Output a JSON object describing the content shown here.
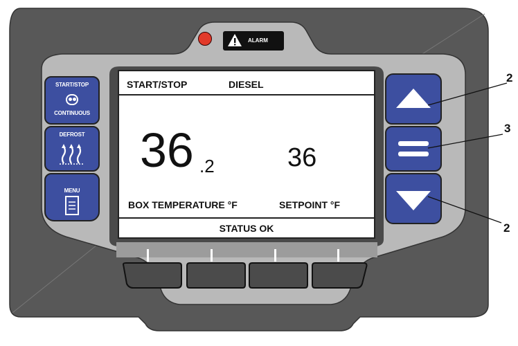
{
  "alarm": {
    "label": "ALARM"
  },
  "left_buttons": {
    "start_stop": {
      "label_top": "START/STOP",
      "label_bottom": "CONTINUOUS"
    },
    "defrost": {
      "label": "DEFROST"
    },
    "menu": {
      "label": "MENU"
    }
  },
  "display": {
    "mode": "START/STOP",
    "engine": "DIESEL",
    "box_temp_whole": "36",
    "box_temp_decimal": ".2",
    "setpoint_value": "36",
    "box_temp_label": "BOX TEMPERATURE °F",
    "setpoint_label": "SETPOINT °F",
    "status": "STATUS OK"
  },
  "callouts": {
    "up": "2",
    "select": "3",
    "down": "2"
  },
  "colors": {
    "button_blue": "#3d4fa0",
    "housing": "#5b5b5b",
    "bezel": "#b9b9b9",
    "lcd": "#ffffff"
  }
}
